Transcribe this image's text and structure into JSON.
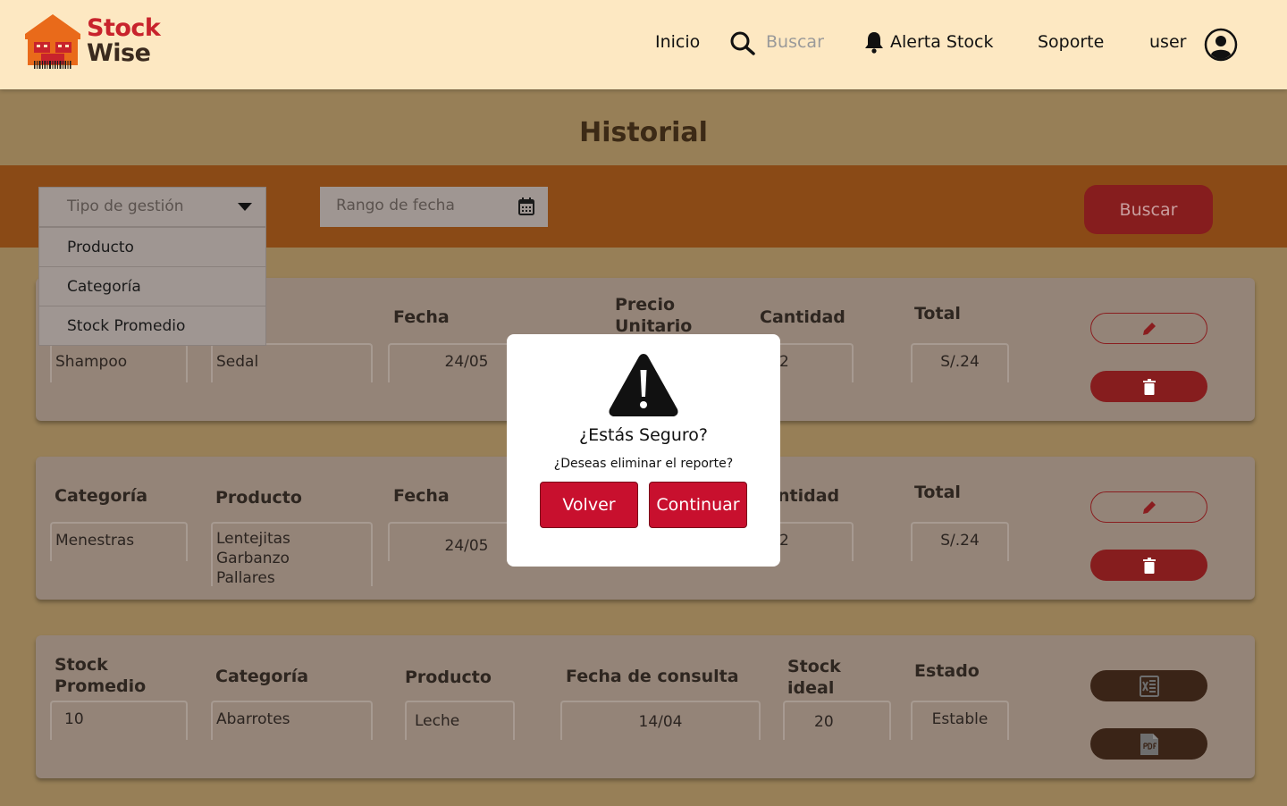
{
  "brand": {
    "line1": "Stock",
    "line2": "Wise"
  },
  "nav": {
    "home": "Inicio",
    "search_placeholder": "Buscar",
    "alert": "Alerta Stock",
    "support": "Soporte",
    "user": "user"
  },
  "page_title": "Historial",
  "filters": {
    "management_type": "Tipo de gestión",
    "dropdown_options": [
      "Producto",
      "Categoría",
      "Stock Promedio"
    ],
    "date_range": "Rango de fecha",
    "search_button": "Buscar"
  },
  "cards": [
    {
      "labels": {
        "date": "Fecha",
        "unit_price_line1": "Precio",
        "unit_price_line2": "Unitario",
        "quantity": "Cantidad",
        "total": "Total"
      },
      "values": {
        "product": "Shampoo",
        "brand": "Sedal",
        "date": "24/05",
        "quantity": "2",
        "total": "S/.24"
      }
    },
    {
      "labels": {
        "category": "Categoría",
        "product": "Producto",
        "date": "Fecha",
        "quantity": "ntidad",
        "total": "Total"
      },
      "values": {
        "category": "Menestras",
        "products": [
          "Lentejitas",
          "Garbanzo",
          "Pallares"
        ],
        "date": "24/05",
        "quantity": "2",
        "total": "S/.24"
      }
    },
    {
      "labels": {
        "avg_stock_line1": "Stock",
        "avg_stock_line2": "Promedio",
        "category": "Categoría",
        "product": "Producto",
        "query_date": "Fecha de consulta",
        "ideal_line1": "Stock",
        "ideal_line2": "ideal",
        "status": "Estado"
      },
      "values": {
        "avg_stock": "10",
        "category": "Abarrotes",
        "product": "Leche",
        "query_date": "14/04",
        "ideal": "20",
        "status": "Estable"
      }
    }
  ],
  "modal": {
    "title": "¿Estás Seguro?",
    "message": "¿Deseas eliminar el reporte?",
    "back_button": "Volver",
    "continue_button": "Continuar"
  },
  "colors": {
    "header_bg": "#fde8c2",
    "page_bg": "#977f57",
    "filter_bar": "#8a4a16",
    "accent_red": "#c8102e",
    "dark_red": "#861d1e",
    "dark_brown": "#3a2417"
  }
}
